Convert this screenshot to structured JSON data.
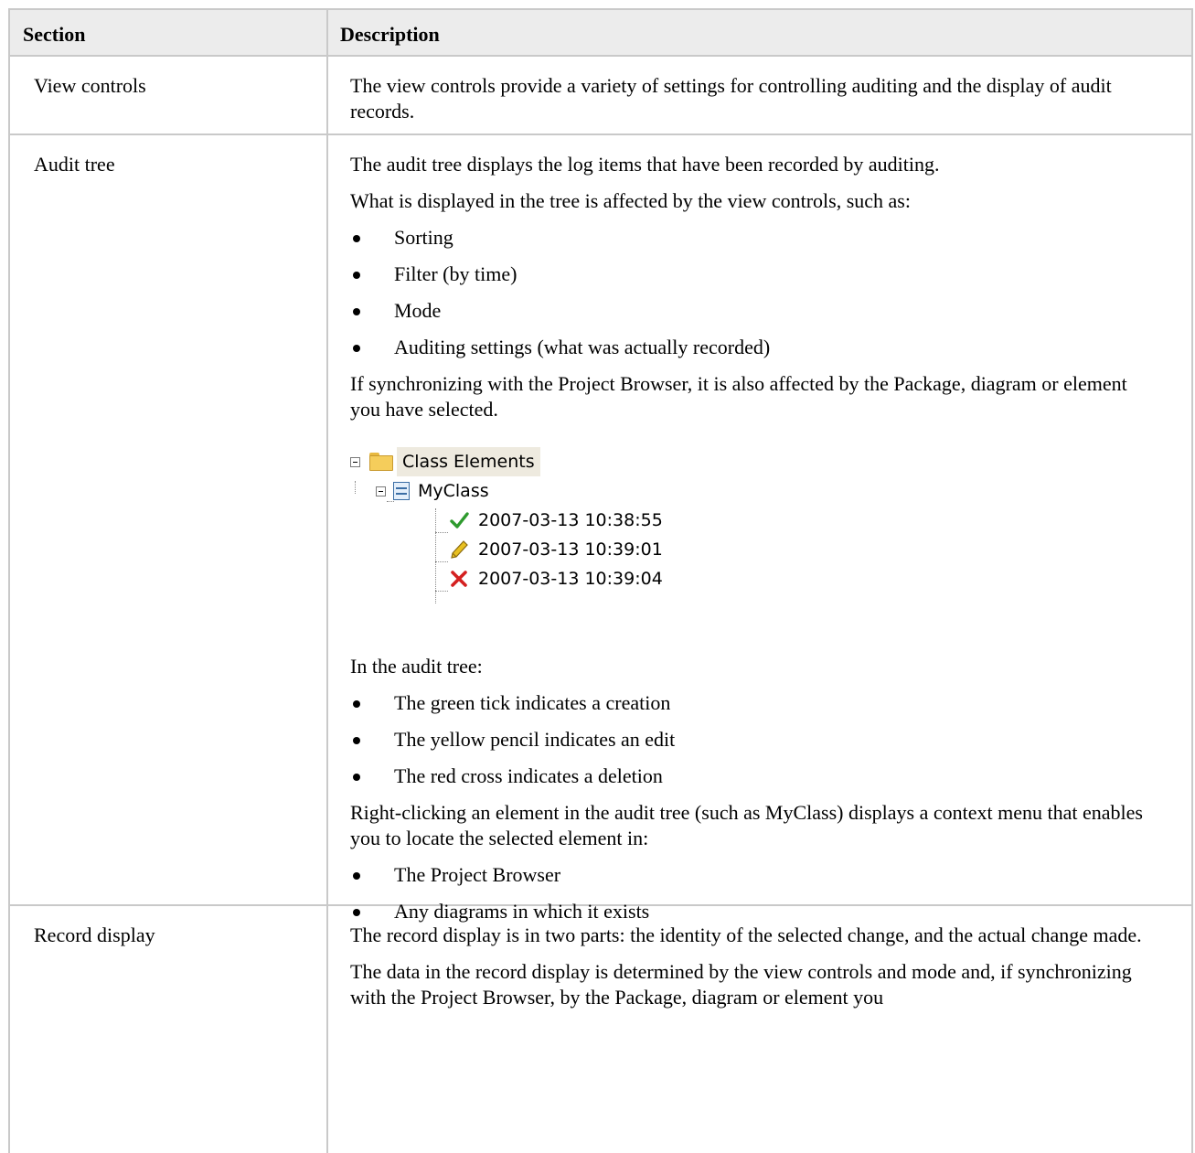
{
  "header": {
    "section": "Section",
    "description": "Description"
  },
  "rows": [
    {
      "section": "View controls",
      "text": "The view controls provide a variety of settings for controlling auditing and the display of audit records."
    },
    {
      "section": "Audit tree",
      "p1": "The audit tree displays the log items that have been recorded by auditing.",
      "p2": "What is displayed in the tree is affected by the view controls, such as:",
      "list1": [
        "Sorting",
        "Filter (by time)",
        "Mode",
        "Auditing settings (what was actually recorded)"
      ],
      "p3": "If synchronizing with the Project Browser, it is also affected by the Package, diagram or element you have selected.",
      "tree": {
        "root": "Class Elements",
        "child": "MyClass",
        "entries": [
          {
            "icon": "green-tick-icon",
            "time": "2007-03-13 10:38:55"
          },
          {
            "icon": "yellow-pencil-icon",
            "time": "2007-03-13 10:39:01"
          },
          {
            "icon": "red-cross-icon",
            "time": "2007-03-13 10:39:04"
          }
        ]
      },
      "p4": "In the audit tree:",
      "list2": [
        "The green tick indicates a creation",
        "The yellow pencil indicates an edit",
        "The red cross indicates a deletion"
      ],
      "p5": "Right-clicking an element in the audit tree (such as MyClass) displays a context menu that enables you to locate the selected element in:",
      "list3": [
        "The Project Browser",
        "Any diagrams in which it exists"
      ]
    },
    {
      "section": "Record display",
      "p1": "The record display is in two parts: the identity of the selected change, and the actual change made.",
      "p2": "The data in the record display is determined by the view controls and mode and, if synchronizing with the Project Browser, by the Package, diagram or element you"
    }
  ],
  "colors": {
    "border": "#c9c9c9",
    "header_bg": "#ececec",
    "tick": "#2e9a2e",
    "pencil": "#e8c020",
    "cross": "#d42020"
  }
}
